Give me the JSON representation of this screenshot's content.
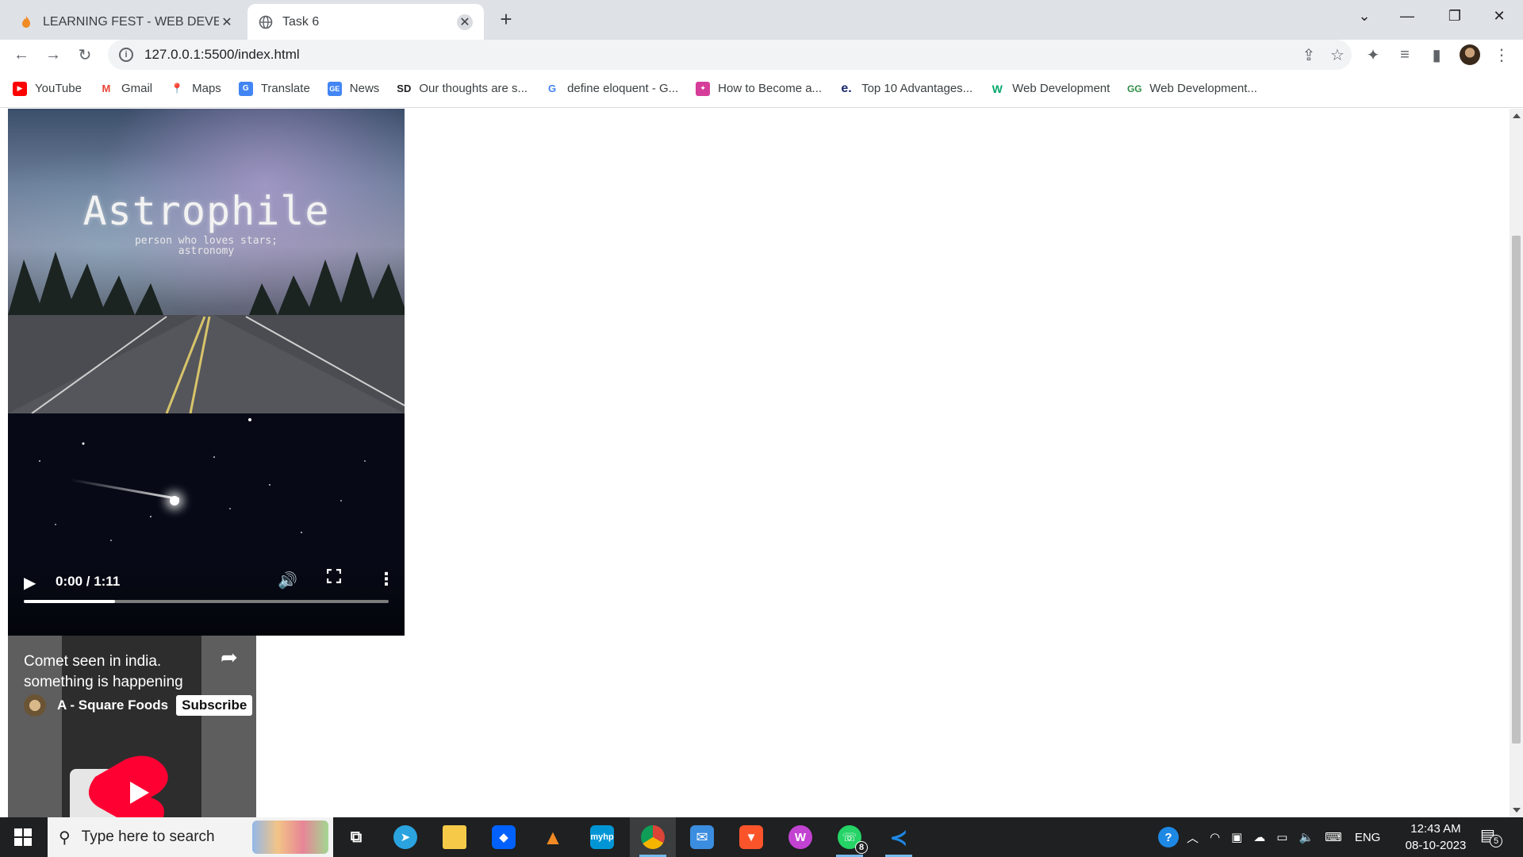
{
  "browser": {
    "tabs": [
      {
        "label": "LEARNING FEST - WEB DEVELOP",
        "active": false
      },
      {
        "label": "Task 6",
        "active": true
      }
    ],
    "url": "127.0.0.1:5500/index.html",
    "bookmarks": [
      {
        "label": "YouTube",
        "icon": "youtube-icon",
        "color": "#ff0000"
      },
      {
        "label": "Gmail",
        "icon": "gmail-icon",
        "color": "#ea4335"
      },
      {
        "label": "Maps",
        "icon": "maps-icon",
        "color": "#34a853"
      },
      {
        "label": "Translate",
        "icon": "translate-icon",
        "color": "#4285f4"
      },
      {
        "label": "News",
        "icon": "news-icon",
        "color": "#4285f4"
      },
      {
        "label": "Our thoughts are s...",
        "icon": "sd-icon",
        "color": "#202124"
      },
      {
        "label": "define eloquent - G...",
        "icon": "google-icon",
        "color": "#4285f4"
      },
      {
        "label": "How to Become a...",
        "icon": "bookmark-icon",
        "color": "#d63d9a"
      },
      {
        "label": "Top 10 Advantages...",
        "icon": "e-icon",
        "color": "#1a2a6c"
      },
      {
        "label": "Web Development",
        "icon": "w3-icon",
        "color": "#04aa6d"
      },
      {
        "label": "Web Development...",
        "icon": "gfg-icon",
        "color": "#2f8d46"
      }
    ]
  },
  "page": {
    "poster": {
      "title": "Astrophile",
      "subtitle_line1": "person who loves stars;",
      "subtitle_line2": "astronomy"
    },
    "video": {
      "time": "0:00 / 1:11",
      "progress": 0.25
    },
    "short": {
      "title_line1": "Comet seen in india.",
      "title_line2": "something is happening",
      "channel": "A - Square Foods",
      "subscribe_label": "Subscribe"
    }
  },
  "taskbar": {
    "search_placeholder": "Type here to search",
    "apps": [
      {
        "icon": "task-view-icon"
      },
      {
        "icon": "telegram-icon",
        "color": "#2aa3df"
      },
      {
        "icon": "file-explorer-icon",
        "color": "#f7c948"
      },
      {
        "icon": "dropbox-icon",
        "color": "#0061fe"
      },
      {
        "icon": "vlc-icon",
        "color": "#f08a24"
      },
      {
        "icon": "myhp-icon",
        "color": "#0096d6"
      },
      {
        "icon": "chrome-icon",
        "color": "#db4437"
      },
      {
        "icon": "mail-icon",
        "color": "#3b8de0"
      },
      {
        "icon": "brave-icon",
        "color": "#fb542b"
      },
      {
        "icon": "wps-icon",
        "color": "#c243d1"
      },
      {
        "icon": "whatsapp-icon",
        "color": "#25d366",
        "badge": "8"
      },
      {
        "icon": "vscode-icon",
        "color": "#1e88e5"
      }
    ],
    "language": "ENG",
    "time": "12:43 AM",
    "date": "08-10-2023",
    "notifications": "5"
  }
}
